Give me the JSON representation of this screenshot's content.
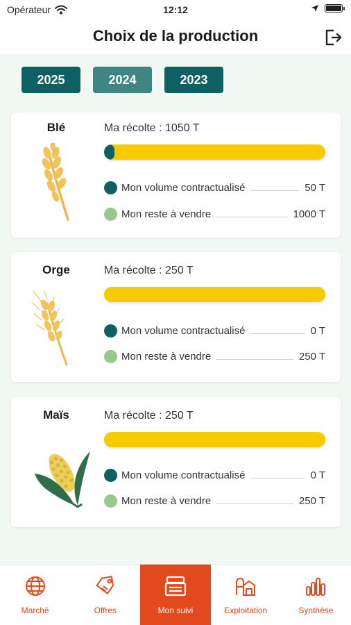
{
  "status_bar": {
    "carrier": "Opérateur",
    "time": "12:12"
  },
  "header": {
    "title": "Choix de la production"
  },
  "colors": {
    "primary": "#0f6063",
    "primary_muted": "#3e8584",
    "harvest_bar": "#f7cb00",
    "contracted": "#0f6063",
    "remaining": "#96c98b",
    "accent": "#e24a1d"
  },
  "years": [
    {
      "label": "2025",
      "state": "selected"
    },
    {
      "label": "2024",
      "state": "muted"
    },
    {
      "label": "2023",
      "state": "normal"
    }
  ],
  "crops": [
    {
      "name": "Blé",
      "icon": "wheat-icon",
      "harvest_label": "Ma récolte : 1050 T",
      "contracted_fraction": 0.048,
      "contracted_label": "Mon volume contractualisé",
      "contracted_value": "50 T",
      "remaining_label": "Mon reste à vendre",
      "remaining_value": "1000 T"
    },
    {
      "name": "Orge",
      "icon": "barley-icon",
      "harvest_label": "Ma récolte : 250 T",
      "contracted_fraction": 0,
      "contracted_label": "Mon volume contractualisé",
      "contracted_value": "0 T",
      "remaining_label": "Mon reste à vendre",
      "remaining_value": "250 T"
    },
    {
      "name": "Maïs",
      "icon": "corn-icon",
      "harvest_label": "Ma récolte : 250 T",
      "contracted_fraction": 0,
      "contracted_label": "Mon volume contractualisé",
      "contracted_value": "0 T",
      "remaining_label": "Mon reste à vendre",
      "remaining_value": "250 T"
    }
  ],
  "tabs": [
    {
      "label": "Marché",
      "icon": "globe-icon",
      "active": false
    },
    {
      "label": "Offres",
      "icon": "price-tag-icon",
      "active": false
    },
    {
      "label": "Mon suivi",
      "icon": "tracking-icon",
      "active": true
    },
    {
      "label": "Exploitation",
      "icon": "farm-icon",
      "active": false
    },
    {
      "label": "Synthèse",
      "icon": "bar-chart-icon",
      "active": false
    }
  ]
}
